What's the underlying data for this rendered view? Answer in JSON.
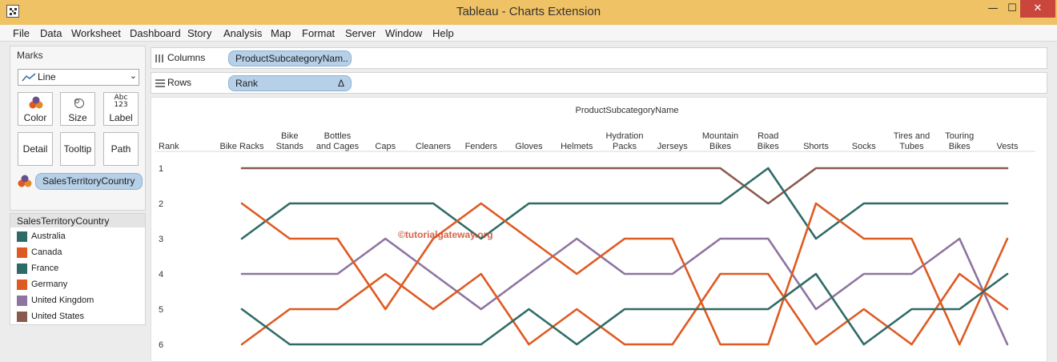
{
  "window": {
    "title": "Tableau - Charts Extension",
    "minimize": "—",
    "maximize": "☐",
    "close": "✕"
  },
  "menu": [
    "File",
    "Data",
    "Worksheet",
    "Dashboard",
    "Story",
    "Analysis",
    "Map",
    "Format",
    "Server",
    "Window",
    "Help"
  ],
  "marks": {
    "title": "Marks",
    "type": "Line",
    "cards": [
      "Color",
      "Size",
      "Label",
      "Detail",
      "Tooltip",
      "Path"
    ],
    "label_icon_text": "Abc\n123",
    "color_field": "SalesTerritoryCountry"
  },
  "legend": {
    "title": "SalesTerritoryCountry",
    "items": [
      {
        "label": "Australia",
        "color": "#2f6b66"
      },
      {
        "label": "Canada",
        "color": "#de5a22"
      },
      {
        "label": "France",
        "color": "#2f6b66"
      },
      {
        "label": "Germany",
        "color": "#de5a22"
      },
      {
        "label": "United Kingdom",
        "color": "#8e74a0"
      },
      {
        "label": "United States",
        "color": "#8a5a4e"
      }
    ]
  },
  "shelves": {
    "columns_label": "Columns",
    "columns_pill": "ProductSubcategoryNam..",
    "rows_label": "Rows",
    "rows_pill": "Rank",
    "rows_pill_delta": "Δ"
  },
  "watermark": "©tutorialgateway.org",
  "chart_data": {
    "type": "line",
    "title": "ProductSubcategoryName",
    "ylabel": "Rank",
    "categories": [
      "Bike Racks",
      "Bike Stands",
      "Bottles and Cages",
      "Caps",
      "Cleaners",
      "Fenders",
      "Gloves",
      "Helmets",
      "Hydration Packs",
      "Jerseys",
      "Mountain Bikes",
      "Road Bikes",
      "Shorts",
      "Socks",
      "Tires and Tubes",
      "Touring Bikes",
      "Vests"
    ],
    "category_lines": [
      [
        "Bike Racks"
      ],
      [
        "Bike",
        "Stands"
      ],
      [
        "Bottles",
        "and Cages"
      ],
      [
        "Caps"
      ],
      [
        "Cleaners"
      ],
      [
        "Fenders"
      ],
      [
        "Gloves"
      ],
      [
        "Helmets"
      ],
      [
        "Hydration",
        "Packs"
      ],
      [
        "Jerseys"
      ],
      [
        "Mountain",
        "Bikes"
      ],
      [
        "Road",
        "Bikes"
      ],
      [
        "Shorts"
      ],
      [
        "Socks"
      ],
      [
        "Tires and",
        "Tubes"
      ],
      [
        "Touring",
        "Bikes"
      ],
      [
        "Vests"
      ]
    ],
    "y_ticks": [
      1,
      2,
      3,
      4,
      5,
      6
    ],
    "ylim": [
      1,
      6
    ],
    "y_inverted": true,
    "series": [
      {
        "color": "#8a5a4e",
        "values": [
          1,
          1,
          1,
          1,
          1,
          1,
          1,
          1,
          1,
          1,
          1,
          2,
          1,
          1,
          1,
          1,
          1
        ]
      },
      {
        "color": "#2f6b66",
        "values": [
          3,
          2,
          2,
          2,
          2,
          3,
          2,
          2,
          2,
          2,
          2,
          1,
          3,
          2,
          2,
          2,
          2
        ]
      },
      {
        "color": "#8e74a0",
        "values": [
          4,
          4,
          4,
          3,
          4,
          5,
          4,
          3,
          4,
          4,
          3,
          3,
          5,
          4,
          4,
          3,
          6
        ]
      },
      {
        "color": "#de5a22",
        "values": [
          2,
          3,
          3,
          5,
          3,
          2,
          3,
          4,
          3,
          3,
          6,
          6,
          2,
          3,
          3,
          6,
          3
        ]
      },
      {
        "color": "#de5a22",
        "values": [
          6,
          5,
          5,
          4,
          5,
          4,
          6,
          5,
          6,
          6,
          4,
          4,
          6,
          5,
          6,
          4,
          5
        ]
      },
      {
        "color": "#2f6b66",
        "values": [
          5,
          6,
          6,
          6,
          6,
          6,
          5,
          6,
          5,
          5,
          5,
          5,
          4,
          6,
          5,
          5,
          4
        ]
      }
    ]
  }
}
